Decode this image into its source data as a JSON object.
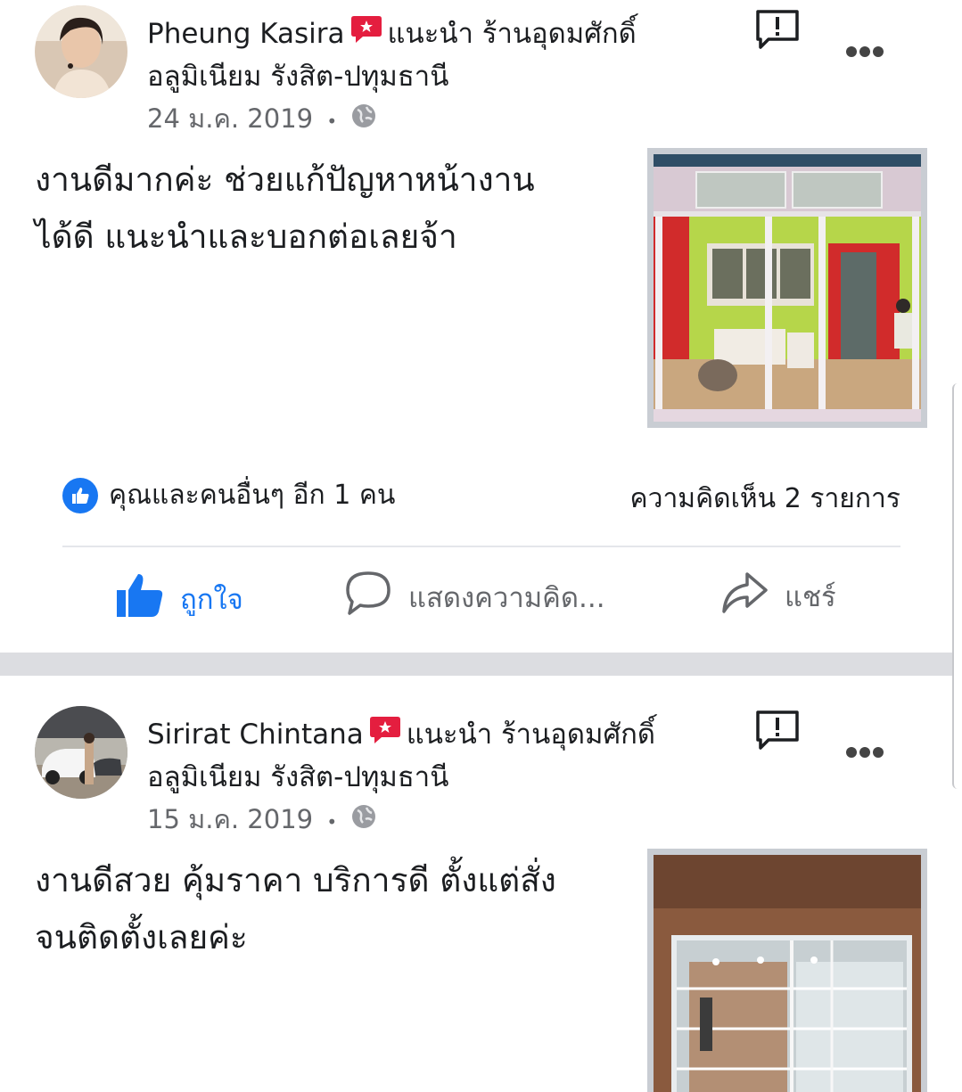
{
  "posts": [
    {
      "author": "Pheung Kasira",
      "action_text": "แนะนำ ร้านอุดมศักดิ์",
      "page_name": "อลูมิเนียม รังสิต-ปทุมธานี",
      "date": "24 ม.ค. 2019",
      "separator": "•",
      "text_lines": [
        "งานดีมากค่ะ ช่วยแก้ปัญหาหน้างาน",
        "ได้ดี  แนะนำและบอกต่อเลยจ้า"
      ],
      "reactions_summary": "คุณและคนอื่นๆ อีก 1 คน",
      "comments_summary": "ความคิดเห็น 2 รายการ",
      "like_label": "ถูกใจ",
      "comment_label": "แสดงความคิด...",
      "share_label": "แชร์"
    },
    {
      "author": "Sirirat Chintana",
      "action_text": "แนะนำ ร้านอุดมศักดิ์",
      "page_name": "อลูมิเนียม รังสิต-ปทุมธานี",
      "date": "15 ม.ค. 2019",
      "separator": "•",
      "text_lines": [
        "งานดีสวย คุ้มราคา บริการดี ตั้งแต่สั่ง",
        "จนติดตั้งเลยค่ะ"
      ]
    }
  ],
  "colors": {
    "accent": "#1877f2",
    "recommend": "#e41e3f",
    "muted": "#65676b",
    "divider": "#dcdde1"
  },
  "icons": [
    "recommend-icon",
    "report-icon",
    "more-icon",
    "globe-icon",
    "like-badge-icon",
    "thumbs-up-icon",
    "comment-icon",
    "share-icon"
  ]
}
